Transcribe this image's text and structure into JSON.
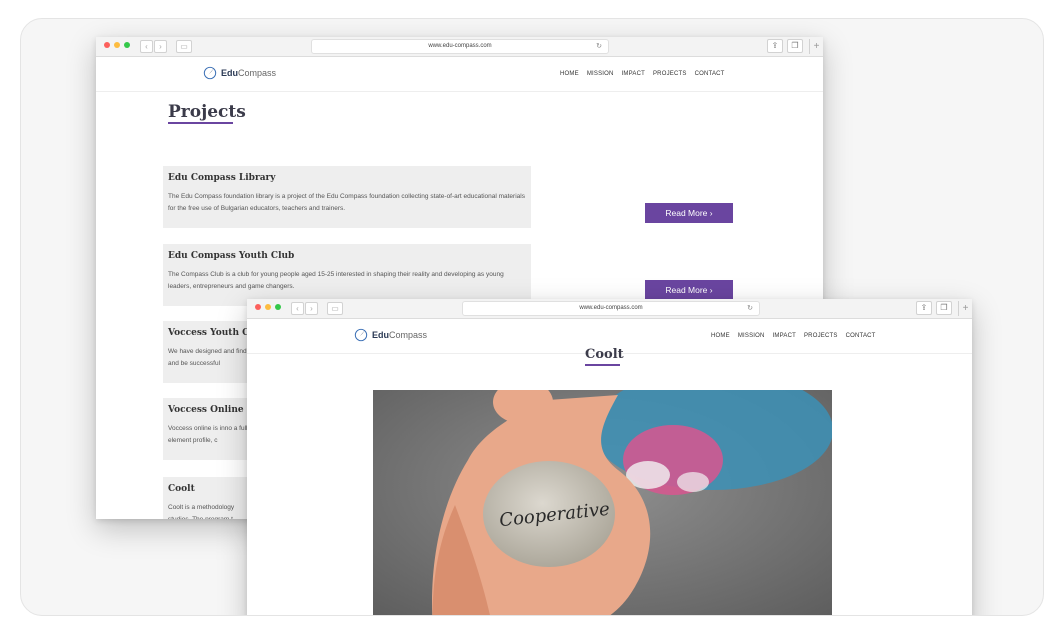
{
  "back_window": {
    "url": "www.edu-compass.com",
    "brand": {
      "bold": "Edu",
      "light": "Compass"
    },
    "nav": [
      "HOME",
      "MISSION",
      "IMPACT",
      "PROJECTS",
      "CONTACT"
    ],
    "page_title": "Projects",
    "projects": [
      {
        "title": "Edu Compass Library",
        "desc": "The Edu Compass foundation library is a project of the Edu Compass foundation collecting state-of-art educational materials for the free use of Bulgarian educators, teachers and trainers.",
        "button": "Read More"
      },
      {
        "title": "Edu Compass Youth Club",
        "desc": "The Compass Club is a club for young people aged 15-25 interested in shaping their reality and developing as young leaders, entrepreneurs and game changers.",
        "button": "Read More"
      },
      {
        "title": "Voccess Youth Ca",
        "desc": "We have designed and find and be successful"
      },
      {
        "title": "Voccess Online",
        "desc": "Voccess online is inno a full element profile, c"
      },
      {
        "title": "Coolt",
        "desc": "Coolt is a methodology studies. The program t"
      }
    ]
  },
  "front_window": {
    "url": "www.edu-compass.com",
    "brand": {
      "bold": "Edu",
      "light": "Compass"
    },
    "nav": [
      "HOME",
      "MISSION",
      "IMPACT",
      "PROJECTS",
      "CONTACT"
    ],
    "page_title": "Coolt",
    "stone_text": "Cooperative"
  },
  "colors": {
    "accent": "#6a45a0",
    "card_bg": "#eeeeee",
    "title": "#3b3b4a"
  },
  "icons": {
    "traffic_lights": "macos-window-controls",
    "logo": "compass-needle-icon",
    "share": "share-icon",
    "tabs": "tabs-icon",
    "reload": "reload-icon",
    "new_tab": "plus-icon",
    "read_more": "chevron-right-icon"
  }
}
